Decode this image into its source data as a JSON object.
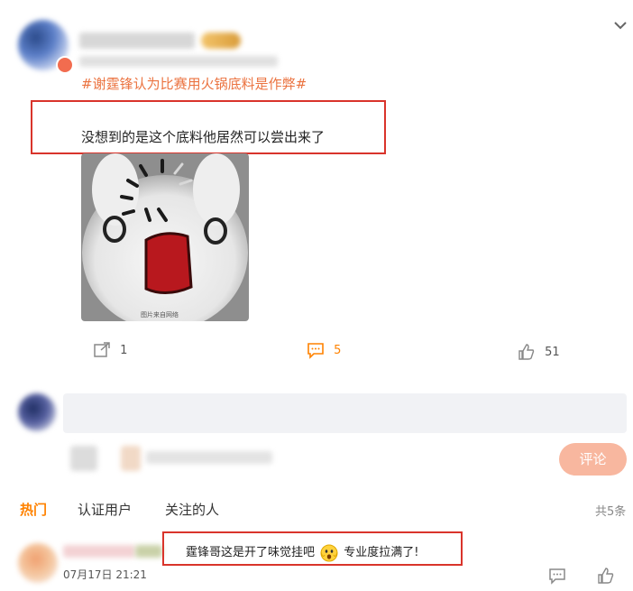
{
  "post": {
    "hashtag": "#谢霆锋认为比赛用火锅底料是作弊#",
    "text": "没想到的是这个底料他居然可以尝出来了",
    "image_caption": "图片来自网络",
    "share_count": "1",
    "comment_count": "5",
    "like_count": "51"
  },
  "composer": {
    "submit_label": "评论"
  },
  "tabs": [
    {
      "label": "热门"
    },
    {
      "label": "认证用户"
    },
    {
      "label": "关注的人"
    }
  ],
  "total_label": "共5条",
  "comment": {
    "text_before": "霆锋哥这是开了味觉挂吧",
    "text_after": "专业度拉满了!",
    "time": "07月17日 21:21"
  },
  "colors": {
    "accent": "#ff8200",
    "hashtag": "#eb7340",
    "highlight_box": "#d9342b",
    "submit_bg": "#f8b79f"
  }
}
